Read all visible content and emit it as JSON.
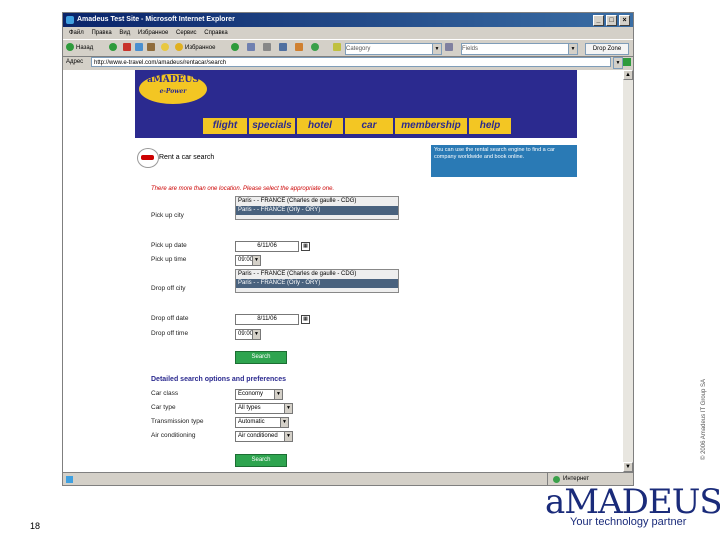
{
  "window": {
    "title": "Amadeus Test Site - Microsoft Internet Explorer",
    "menu": [
      "Файл",
      "Правка",
      "Вид",
      "Избранное",
      "Сервис",
      "Справка"
    ],
    "toolbar": {
      "back_label": "Назад",
      "favorites_label": "Избранное",
      "category_placeholder": "Category",
      "fields_placeholder": "Fields",
      "drop_zone": "Drop Zone"
    },
    "address_label": "Адрес",
    "address_value": "http://www.e-travel.com/amadeus/rentacar/search",
    "status_zone": "Интернет"
  },
  "site": {
    "logo_main": "aMADEUS",
    "logo_sub": "e-Power",
    "tabs": [
      "flight",
      "specials",
      "hotel",
      "car",
      "membership",
      "help"
    ],
    "search_title": "Rent a car search",
    "info_text": "You can use the rental search engine to find a car company worldwide and book online.",
    "warning": "There are more than one location. Please select the appropriate one.",
    "pickup_city_label": "Pick up city",
    "pickup_options": [
      "Paris - - FRANCE (Charles de gaulle - CDG)",
      "Paris - - FRANCE (Orly - ORY)"
    ],
    "pickup_date_label": "Pick up date",
    "pickup_date": "6/11/06",
    "pickup_time_label": "Pick up time",
    "pickup_time": "09:00",
    "dropoff_city_label": "Drop off city",
    "dropoff_options": [
      "Paris - - FRANCE (Charles de gaulle - CDG)",
      "Paris - - FRANCE (Orly - ORY)"
    ],
    "dropoff_date_label": "Drop off date",
    "dropoff_date": "8/11/06",
    "dropoff_time_label": "Drop off time",
    "dropoff_time": "09:00",
    "search_button": "Search",
    "detailed_title": "Detailed search options and preferences",
    "car_class_label": "Car class",
    "car_class": "Economy",
    "car_type_label": "Car type",
    "car_type": "All types",
    "transmission_label": "Transmission type",
    "transmission": "Automatic",
    "aircon_label": "Air conditioning",
    "aircon": "Air conditioned",
    "search_button2": "Search"
  },
  "slide": {
    "number": "18",
    "copyright": "© 2006 Amadeus IT Group SA",
    "brand": "aMADEUS",
    "tagline": "Your technology partner"
  },
  "colors": {
    "site_blue": "#2b2a8f",
    "site_yellow": "#f3c623",
    "button_green": "#2ea44f"
  }
}
